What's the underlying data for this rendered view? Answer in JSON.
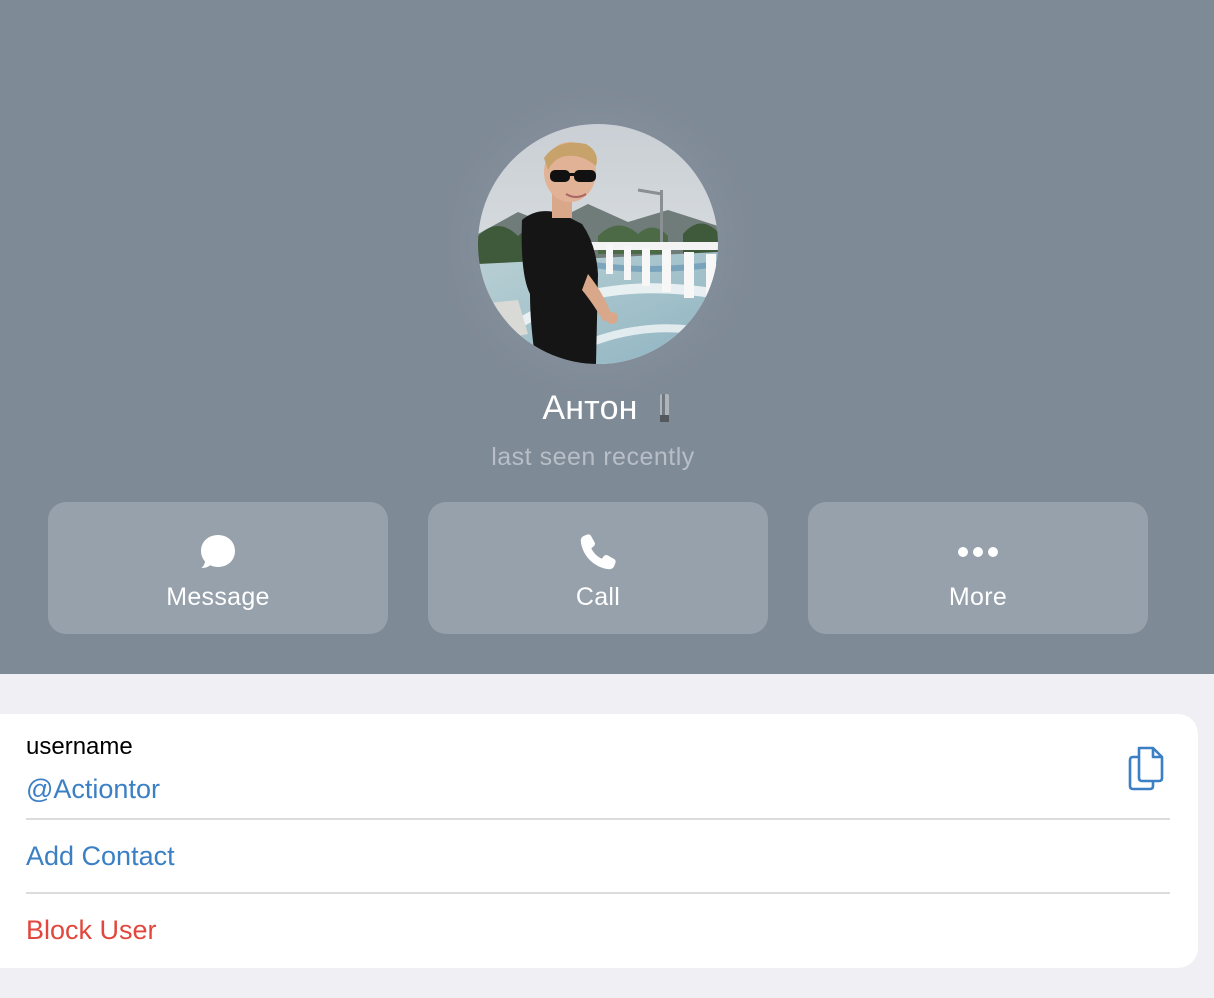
{
  "profile": {
    "name": "Антон",
    "status": "last seen recently",
    "avatar_icon": "profile-photo",
    "status_emoji_icon": "custom-emoji"
  },
  "actions": [
    {
      "label": "Message",
      "icon": "chat-bubble-icon"
    },
    {
      "label": "Call",
      "icon": "phone-icon"
    },
    {
      "label": "More",
      "icon": "ellipsis-icon"
    }
  ],
  "info": {
    "username_label": "username",
    "username_value": "@Actiontor",
    "copy_icon": "copy-icon",
    "add_contact": "Add Contact",
    "block_user": "Block User"
  },
  "colors": {
    "header_bg": "#7e8a96",
    "page_bg": "#efeff4",
    "link": "#3b7fc4",
    "danger": "#e2463c"
  }
}
